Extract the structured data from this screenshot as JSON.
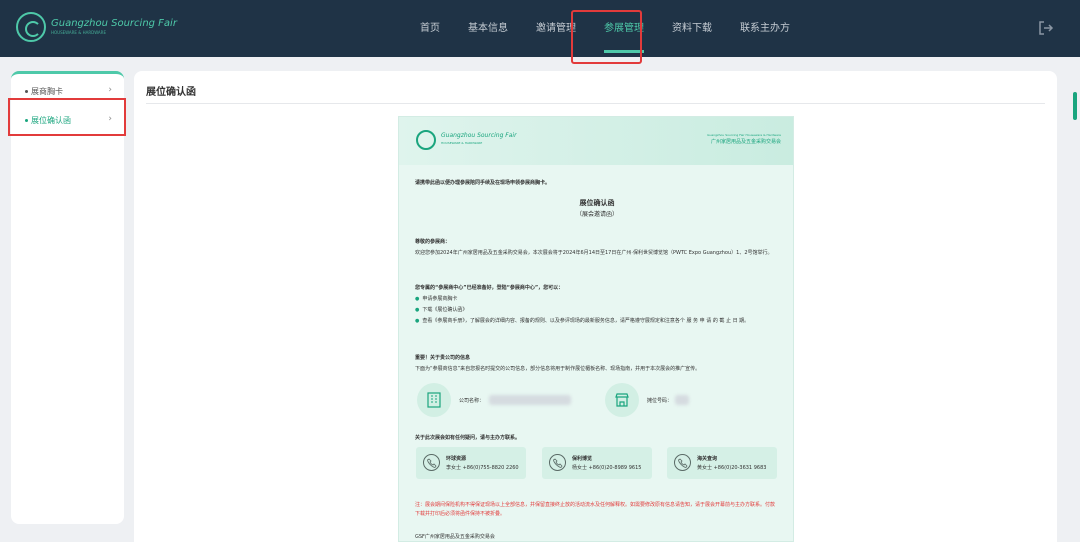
{
  "brand": {
    "name": "Guangzhou Sourcing Fair",
    "sub": "HOUSEWARE & HARDWARE"
  },
  "nav": [
    {
      "label": "首页"
    },
    {
      "label": "基本信息"
    },
    {
      "label": "邀请管理"
    },
    {
      "label": "参展管理",
      "active": true
    },
    {
      "label": "资料下载"
    },
    {
      "label": "联系主办方"
    }
  ],
  "sidebar": {
    "items": [
      {
        "label": "展商胸卡"
      },
      {
        "label": "展位确认函",
        "active": true
      }
    ]
  },
  "main": {
    "title": "展位确认函"
  },
  "letter": {
    "brand": "Guangzhou Sourcing Fair",
    "brand_sub": "HOUSEWARE & HARDWARE",
    "right1": "Guangzhou Sourcing Fair Houseware & Hardware",
    "right2": "广州家居用品及五金采购交易会",
    "notice": "请携带此函以便办理参展陪同手续及在现场申领参展商胸卡。",
    "title": "展位确认函",
    "subtitle": "（展会邀请函）",
    "greeting": "尊敬的参展商：",
    "intro": "欢迎您参加2024年广州家居用品及五金采购交易会，本次展会将于2024年6月14日至17日在广州·保利世贸博览馆（PWTC Expo Guangzhou）1、2号馆举行。",
    "center_heading": "您专属的“参展商中心”已经准备好，登陆“参展商中心”，您可以：",
    "bullets": [
      "申请参展商胸卡",
      "下载《展位确认函》",
      "查看《参展商手册》，了解展会的详细内容、报备的规则、以及参评现场的最新服务信息，请严格遵守展规定和注意各个 服 务 申 请 的 截 止 日 期。"
    ],
    "important_heading": "重要！关于贵公司的信息",
    "important_text": "下面为“参展商信息”来自您报名时提交的公司信息，部分信息将用于制作展位楣板名称、现场指南，并用于本次展会的推广宣传。",
    "company_label": "公司名称：",
    "booth_label": "摊位号码：",
    "contact_heading": "关于此次展会如有任何疑问，请与主办方联系。",
    "contacts": [
      {
        "name": "环球资源",
        "phone": "李女士 +86(0)755-8820 2260"
      },
      {
        "name": "保利博览",
        "phone": "杨女士 +86(0)20-8989 9615"
      },
      {
        "name": "海关查询",
        "phone": "黄女士 +86(0)20-3631 9683"
      }
    ],
    "red_note": "注：展会期间保险机构不得保证现场以上全部信息，并保留直接终止放的活动流水及任何解释权。如需要修改原有信息请告知，请于展会开幕前与主办方联系。付款下载并打印后必须将函件保持不被折叠。",
    "footer": "GSF广州家居用品及五金采购交易会"
  }
}
